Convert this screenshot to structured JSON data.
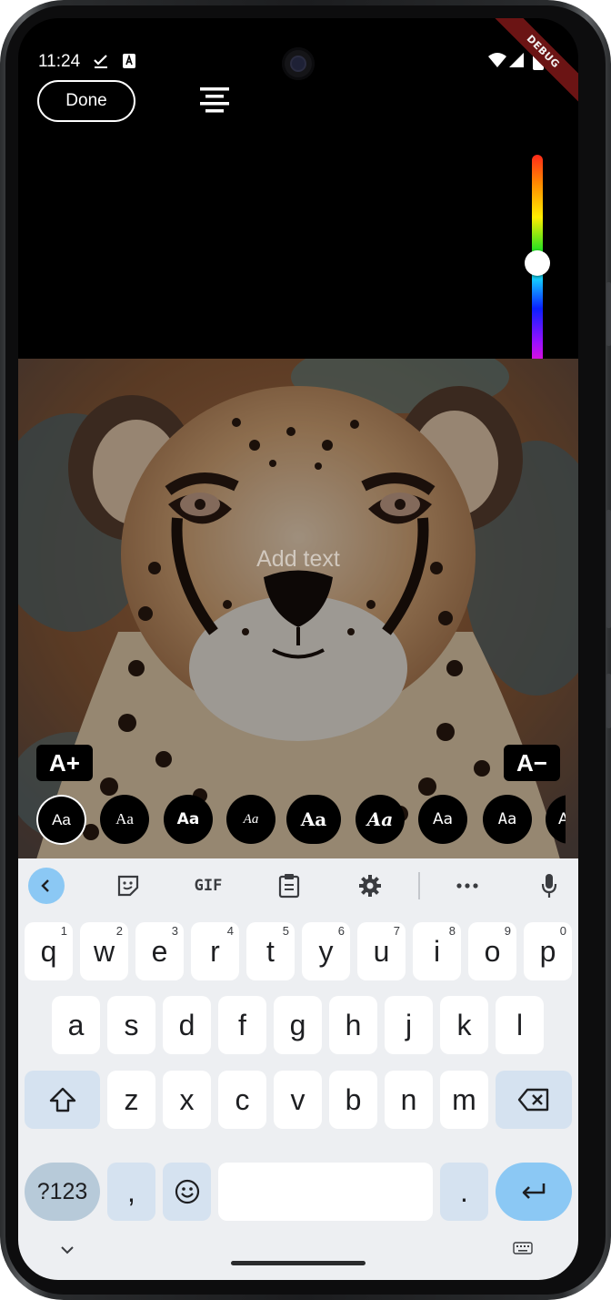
{
  "status_bar": {
    "time": "11:24",
    "debug_label": "DEBUG"
  },
  "toolbar": {
    "done_label": "Done"
  },
  "canvas": {
    "placeholder": "Add text",
    "increase_label": "A+",
    "decrease_label": "A−",
    "color_slider_level": 0.45
  },
  "font_styles": [
    "Aa",
    "Aa",
    "Aa",
    "Aa",
    "Aa",
    "Aa",
    "Aa",
    "Aa",
    "A"
  ],
  "keyboard": {
    "toolbar": {
      "gif_label": "GIF"
    },
    "row1": [
      {
        "key": "q",
        "hint": "1"
      },
      {
        "key": "w",
        "hint": "2"
      },
      {
        "key": "e",
        "hint": "3"
      },
      {
        "key": "r",
        "hint": "4"
      },
      {
        "key": "t",
        "hint": "5"
      },
      {
        "key": "y",
        "hint": "6"
      },
      {
        "key": "u",
        "hint": "7"
      },
      {
        "key": "i",
        "hint": "8"
      },
      {
        "key": "o",
        "hint": "9"
      },
      {
        "key": "p",
        "hint": "0"
      }
    ],
    "row2": [
      "a",
      "s",
      "d",
      "f",
      "g",
      "h",
      "j",
      "k",
      "l"
    ],
    "row3": [
      "z",
      "x",
      "c",
      "v",
      "b",
      "n",
      "m"
    ],
    "symbols_label": "?123",
    "comma_label": ",",
    "period_label": "."
  }
}
